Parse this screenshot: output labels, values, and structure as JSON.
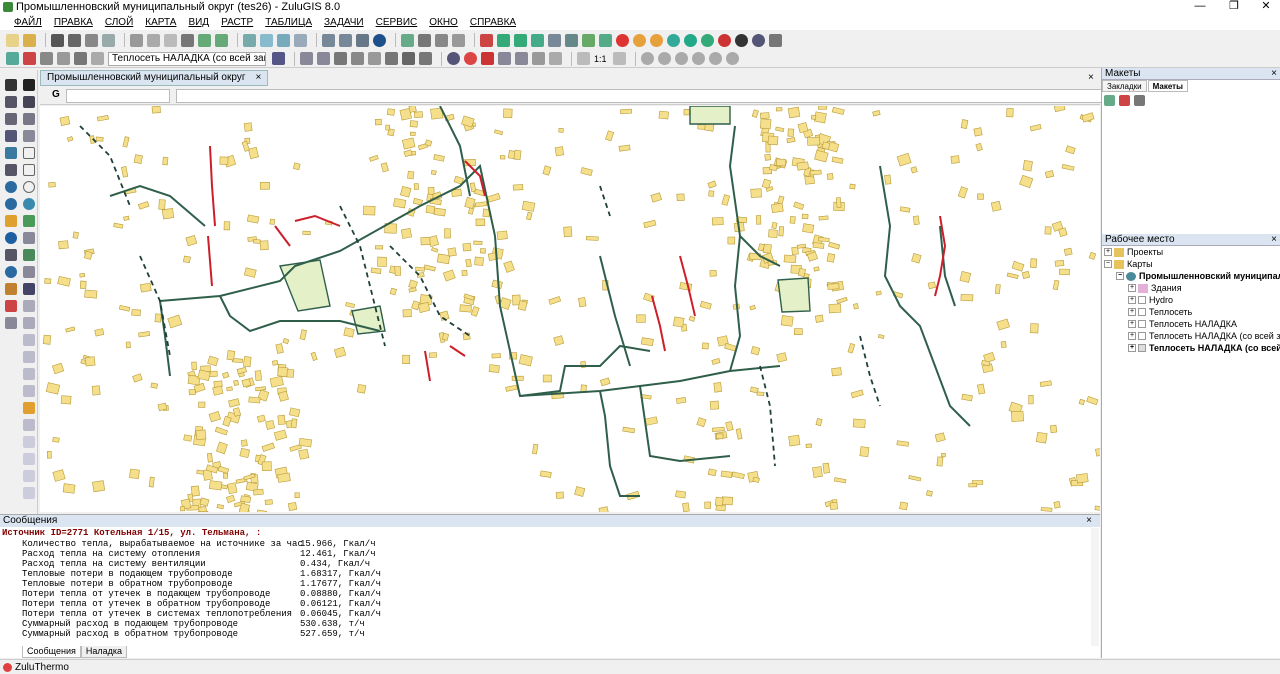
{
  "window": {
    "title": "Промышленновский муниципальный округ (tes26) - ZuluGIS 8.0",
    "minimize": "—",
    "maximize": "❐",
    "close": "✕"
  },
  "menu": [
    "ФАЙЛ",
    "ПРАВКА",
    "СЛОЙ",
    "КАРТА",
    "ВИД",
    "РАСТР",
    "ТАБЛИЦА",
    "ЗАДАЧИ",
    "СЕРВИС",
    "ОКНО",
    "СПРАВКА"
  ],
  "toolbar2": {
    "active_layer": "Теплосеть НАЛАДКА (со всей зам",
    "scale_label": "1:1"
  },
  "doc_tab": {
    "label": "Промышленновский муниципальный округ",
    "close": "×"
  },
  "gbar": {
    "label": "G"
  },
  "map_close": "×",
  "right_panel": {
    "top": {
      "title": "Макеты",
      "close": "×",
      "tabs": [
        "Закладки",
        "Макеты"
      ]
    },
    "workspace": {
      "title": "Рабочее место",
      "close": "×"
    },
    "tree": {
      "projects": "Проекты",
      "maps": "Карты",
      "map_name": "Промышленновский муниципальный о",
      "layers": [
        "Здания",
        "Hydro",
        "Теплосеть",
        "Теплосеть НАЛАДКА",
        "Теплосеть НАЛАДКА (со всей заме",
        "Теплосеть НАЛАДКА (со всей за"
      ]
    }
  },
  "messages": {
    "title": "Сообщения",
    "close": "×",
    "header": "Источник ID=2771 Котельная 1/15, ул. Тельмана, :",
    "lines": [
      {
        "label": "Количество тепла, вырабатываемое на источнике за час",
        "value": "15.966, Гкал/ч"
      },
      {
        "label": "Расход тепла на систему отопления",
        "value": "12.461, Гкал/ч"
      },
      {
        "label": "Расход тепла на систему вентиляции",
        "value": "0.434, Гкал/ч"
      },
      {
        "label": "Тепловые потери в подающем трубопроводе",
        "value": "1.68317, Гкал/ч"
      },
      {
        "label": "Тепловые потери в обратном трубопроводе",
        "value": "1.17677, Гкал/ч"
      },
      {
        "label": "Потери тепла от утечек в подающем трубопроводе",
        "value": "0.08880, Гкал/ч"
      },
      {
        "label": "Потери тепла от утечек в обратном трубопроводе",
        "value": "0.06121, Гкал/ч"
      },
      {
        "label": "Потери тепла от утечек в системах теплопотребления",
        "value": "0.06045, Гкал/ч"
      },
      {
        "label": "Суммарный расход в подающем трубопроводе",
        "value": "530.638, т/ч"
      },
      {
        "label": "Суммарный расход в обратном трубопроводе",
        "value": "527.659, т/ч"
      }
    ],
    "tabs": [
      "Сообщения",
      "Наладка"
    ]
  },
  "status": {
    "text": "ZuluThermo"
  },
  "colors": {
    "building_fill": "#f5df8a",
    "building_stroke": "#b89b3a",
    "network": "#2f5f4a",
    "network_alt": "#1e3f3a",
    "red_line": "#cc1f2a",
    "panel_head": "#dbe5f1"
  }
}
